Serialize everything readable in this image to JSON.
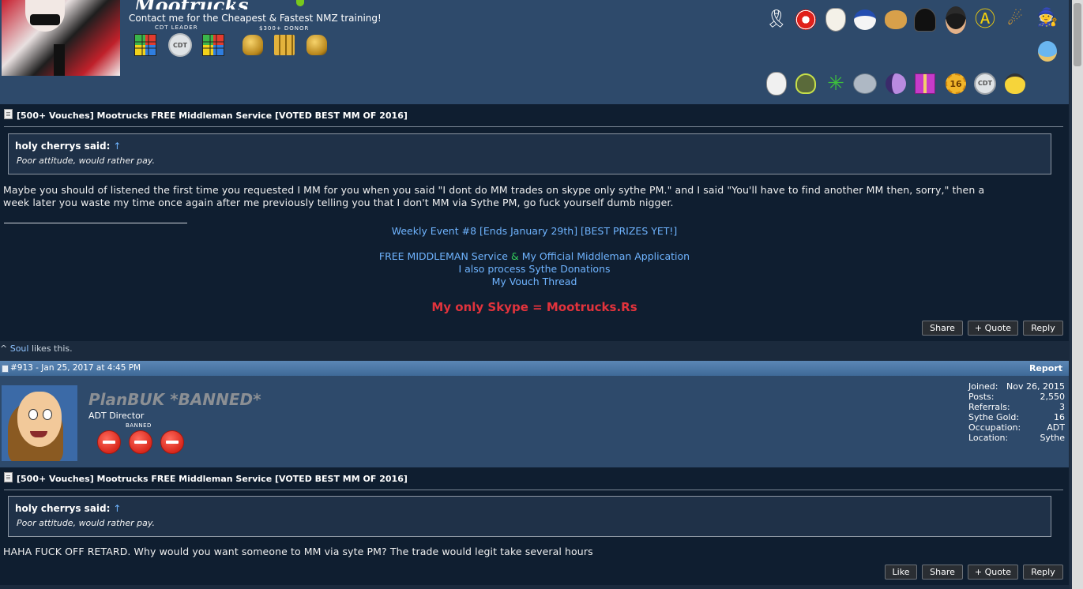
{
  "post1": {
    "title_text": "Mootrucks",
    "tagline": "Contact me for the Cheapest & Fastest NMZ training!",
    "badge_captions": {
      "cdt_leader": "CDT LEADER",
      "donor": "$300+ DONOR"
    },
    "cdt_badge": "CDT",
    "trophy_row1": [
      "ribbon-icon",
      "poker-chip-icon",
      "guy-fawkes-mask-icon",
      "duck-icon",
      "pepe-icon",
      "darth-vader-icon",
      "ninja-icon",
      "anarchy-icon",
      "rocket-2016-icon",
      "wizard-icon",
      "squirtle-icon"
    ],
    "trophy_row2": [
      "wojak-icon",
      "alien-icon",
      "leaf-icon",
      "hedgehog-icon",
      "pony-icon",
      "gift-icon",
      "sixteen-badge-icon",
      "cdt-badge-icon",
      "pikachu-icon"
    ],
    "sixteen": "16",
    "thread_title": "[500+ Vouches] Mootrucks FREE Middleman Service [VOTED BEST MM OF 2016]",
    "quote": {
      "author": "holy cherrys said:",
      "arrow": "↑",
      "text": "Poor attitude, would rather pay."
    },
    "body_line1": "Maybe you should of listened the first time you requested I MM for you when you said \"I dont do MM trades on skype only sythe PM.\" and I said \"You'll have to find another MM then, sorry,\" then a",
    "body_line2": "week later you waste my time once again after me previously telling you that I don't MM via Sythe PM, go fuck yourself dumb nigger.",
    "signature": {
      "event": "Weekly Event #8 [Ends January 29th] [BEST PRIZES YET!]",
      "mm_service": "FREE MIDDLEMAN Service",
      "amp": "&",
      "mm_application": "My Official Middleman Application",
      "donations": "I also process Sythe Donations",
      "vouch": "My Vouch Thread",
      "skype": "My only Skype = Mootrucks.Rs"
    },
    "buttons": {
      "share": "Share",
      "quote": "+ Quote",
      "reply": "Reply"
    },
    "likes": {
      "user": "Soul",
      "suffix": " likes this.",
      "prefix": "^ "
    }
  },
  "post2": {
    "header": {
      "num": "#913 - Jan 25, 2017 at 4:45 PM",
      "report": "Report"
    },
    "username": "PlanBUK *BANNED*",
    "rank": "ADT Director",
    "banned_caption": "BANNED",
    "stats": [
      {
        "label": "Joined:",
        "value": "Nov 26, 2015"
      },
      {
        "label": "Posts:",
        "value": "2,550"
      },
      {
        "label": "Referrals:",
        "value": "3"
      },
      {
        "label": "Sythe Gold:",
        "value": "16"
      },
      {
        "label": "Occupation:",
        "value": "ADT"
      },
      {
        "label": "Location:",
        "value": "Sythe"
      }
    ],
    "thread_title": "[500+ Vouches] Mootrucks FREE Middleman Service [VOTED BEST MM OF 2016]",
    "quote": {
      "author": "holy cherrys said:",
      "arrow": "↑",
      "text": "Poor attitude, would rather pay."
    },
    "body": "HAHA FUCK OFF RETARD. Why would you want someone to MM via syte PM? The trade would legit take several hours",
    "buttons": {
      "like": "Like",
      "share": "Share",
      "quote": "+ Quote",
      "reply": "Reply"
    }
  },
  "colors": {
    "panel": "#0f1e30",
    "userbar": "#2e4a6b",
    "link": "#6fb4ff",
    "skype": "#e2333c",
    "header": "#4f7aa8"
  }
}
